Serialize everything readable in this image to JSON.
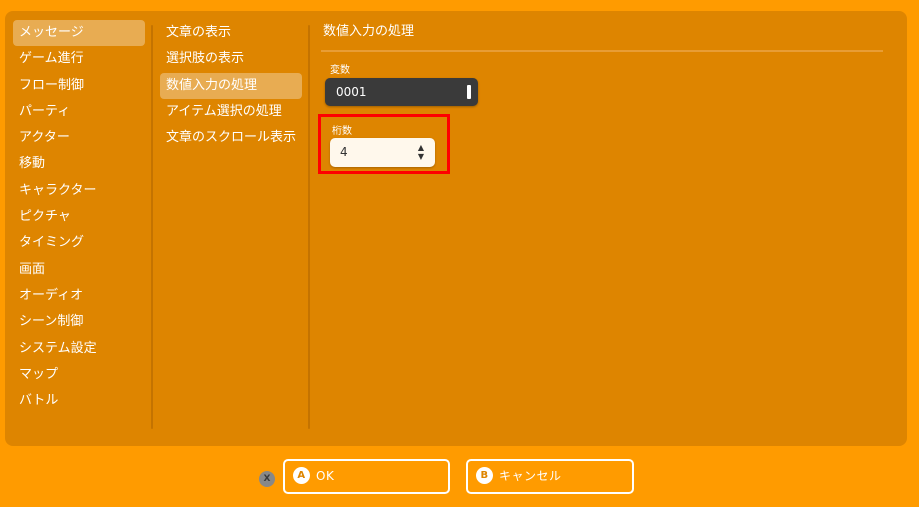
{
  "categories": [
    {
      "label": "メッセージ",
      "selected": true
    },
    {
      "label": "ゲーム進行",
      "selected": false
    },
    {
      "label": "フロー制御",
      "selected": false
    },
    {
      "label": "パーティ",
      "selected": false
    },
    {
      "label": "アクター",
      "selected": false
    },
    {
      "label": "移動",
      "selected": false
    },
    {
      "label": "キャラクター",
      "selected": false
    },
    {
      "label": "ピクチャ",
      "selected": false
    },
    {
      "label": "タイミング",
      "selected": false
    },
    {
      "label": "画面",
      "selected": false
    },
    {
      "label": "オーディオ",
      "selected": false
    },
    {
      "label": "シーン制御",
      "selected": false
    },
    {
      "label": "システム設定",
      "selected": false
    },
    {
      "label": "マップ",
      "selected": false
    },
    {
      "label": "バトル",
      "selected": false
    }
  ],
  "commands": [
    {
      "label": "文章の表示",
      "selected": false
    },
    {
      "label": "選択肢の表示",
      "selected": false
    },
    {
      "label": "数値入力の処理",
      "selected": true
    },
    {
      "label": "アイテム選択の処理",
      "selected": false
    },
    {
      "label": "文章のスクロール表示",
      "selected": false
    }
  ],
  "content": {
    "title": "数値入力の処理",
    "variable_label": "変数",
    "variable_value": "0001",
    "digits_label": "桁数",
    "digits_value": "4",
    "spin_up": "▲",
    "spin_down": "▼"
  },
  "footer": {
    "x_badge": "X",
    "ok_badge": "A",
    "ok_label": "OK",
    "cancel_badge": "B",
    "cancel_label": "キャンセル"
  },
  "colors": {
    "background": "#ff9b00",
    "panel": "#de8500",
    "selection": "#e8a94c",
    "input_dark": "#3a3a3a",
    "input_light": "#fff8ec",
    "highlight": "#ff0000"
  }
}
